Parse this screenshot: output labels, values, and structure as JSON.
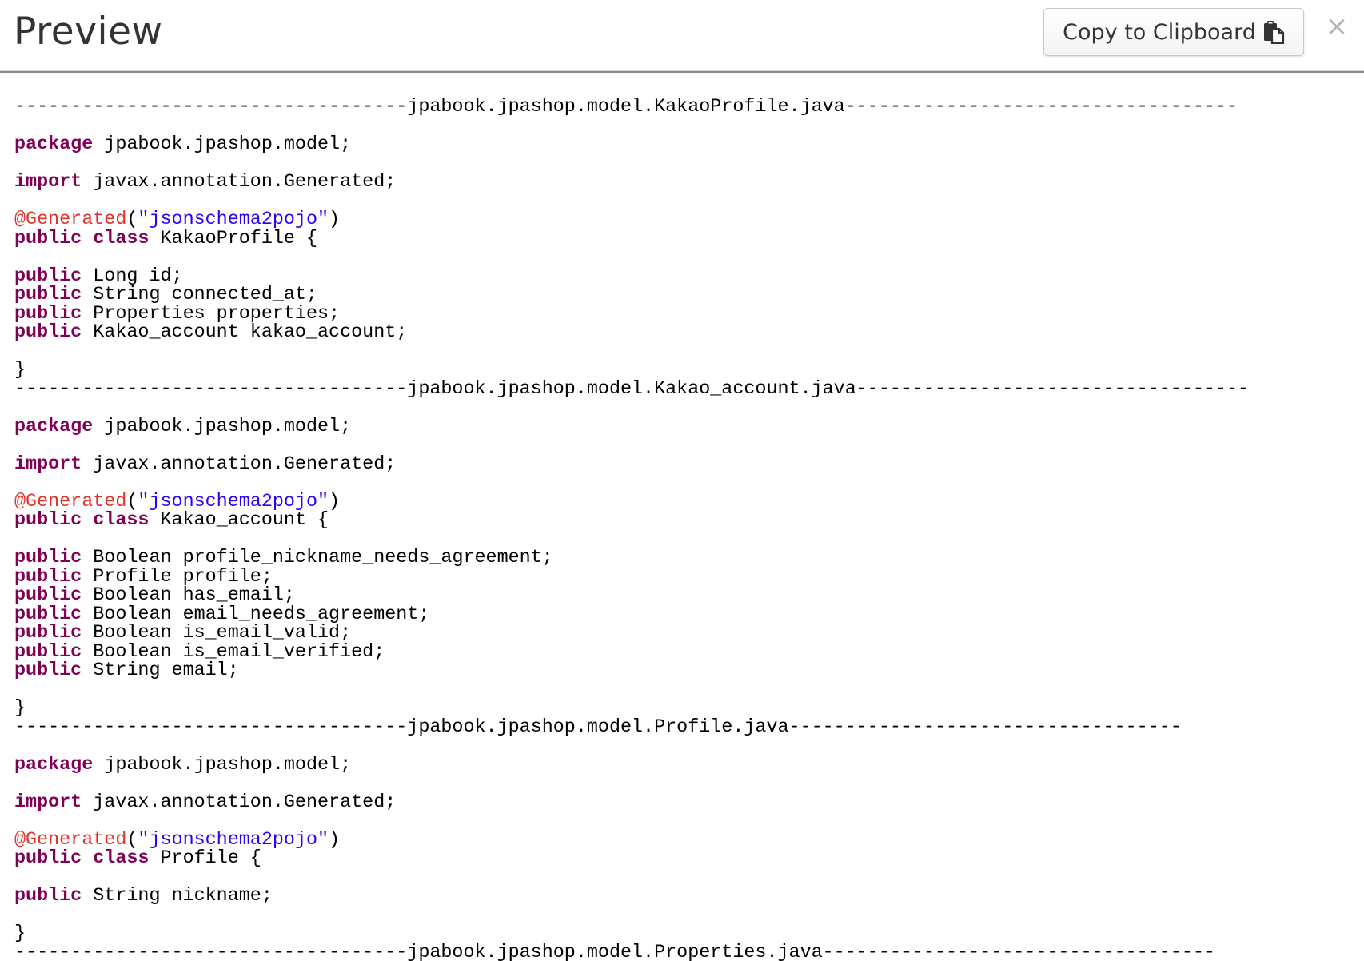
{
  "header": {
    "title": "Preview",
    "copy_button_label": "Copy to Clipboard",
    "copy_icon": "clipboard-icon",
    "close_label": "×"
  },
  "colors": {
    "keyword": "#7f0055",
    "annotation": "#e0332a",
    "string": "#2a00ff",
    "text": "#000000"
  },
  "code_lines": [
    [
      {
        "t": "-----------------------------------jpabook.jpashop.model.KakaoProfile.java-----------------------------------",
        "k": "p"
      }
    ],
    [],
    [
      {
        "t": "package",
        "k": "kw"
      },
      {
        "t": " jpabook.jpashop.model;",
        "k": "p"
      }
    ],
    [],
    [
      {
        "t": "import",
        "k": "kw"
      },
      {
        "t": " javax.annotation.Generated;",
        "k": "p"
      }
    ],
    [],
    [
      {
        "t": "@Generated",
        "k": "ann"
      },
      {
        "t": "(",
        "k": "p"
      },
      {
        "t": "\"jsonschema2pojo\"",
        "k": "str"
      },
      {
        "t": ")",
        "k": "p"
      }
    ],
    [
      {
        "t": "public",
        "k": "kw"
      },
      {
        "t": " ",
        "k": "p"
      },
      {
        "t": "class",
        "k": "kw"
      },
      {
        "t": " KakaoProfile {",
        "k": "p"
      }
    ],
    [],
    [
      {
        "t": "public",
        "k": "kw"
      },
      {
        "t": " Long id;",
        "k": "p"
      }
    ],
    [
      {
        "t": "public",
        "k": "kw"
      },
      {
        "t": " String connected_at;",
        "k": "p"
      }
    ],
    [
      {
        "t": "public",
        "k": "kw"
      },
      {
        "t": " Properties properties;",
        "k": "p"
      }
    ],
    [
      {
        "t": "public",
        "k": "kw"
      },
      {
        "t": " Kakao_account kakao_account;",
        "k": "p"
      }
    ],
    [],
    [
      {
        "t": "}",
        "k": "p"
      }
    ],
    [
      {
        "t": "-----------------------------------jpabook.jpashop.model.Kakao_account.java-----------------------------------",
        "k": "p"
      }
    ],
    [],
    [
      {
        "t": "package",
        "k": "kw"
      },
      {
        "t": " jpabook.jpashop.model;",
        "k": "p"
      }
    ],
    [],
    [
      {
        "t": "import",
        "k": "kw"
      },
      {
        "t": " javax.annotation.Generated;",
        "k": "p"
      }
    ],
    [],
    [
      {
        "t": "@Generated",
        "k": "ann"
      },
      {
        "t": "(",
        "k": "p"
      },
      {
        "t": "\"jsonschema2pojo\"",
        "k": "str"
      },
      {
        "t": ")",
        "k": "p"
      }
    ],
    [
      {
        "t": "public",
        "k": "kw"
      },
      {
        "t": " ",
        "k": "p"
      },
      {
        "t": "class",
        "k": "kw"
      },
      {
        "t": " Kakao_account {",
        "k": "p"
      }
    ],
    [],
    [
      {
        "t": "public",
        "k": "kw"
      },
      {
        "t": " Boolean profile_nickname_needs_agreement;",
        "k": "p"
      }
    ],
    [
      {
        "t": "public",
        "k": "kw"
      },
      {
        "t": " Profile profile;",
        "k": "p"
      }
    ],
    [
      {
        "t": "public",
        "k": "kw"
      },
      {
        "t": " Boolean has_email;",
        "k": "p"
      }
    ],
    [
      {
        "t": "public",
        "k": "kw"
      },
      {
        "t": " Boolean email_needs_agreement;",
        "k": "p"
      }
    ],
    [
      {
        "t": "public",
        "k": "kw"
      },
      {
        "t": " Boolean is_email_valid;",
        "k": "p"
      }
    ],
    [
      {
        "t": "public",
        "k": "kw"
      },
      {
        "t": " Boolean is_email_verified;",
        "k": "p"
      }
    ],
    [
      {
        "t": "public",
        "k": "kw"
      },
      {
        "t": " String email;",
        "k": "p"
      }
    ],
    [],
    [
      {
        "t": "}",
        "k": "p"
      }
    ],
    [
      {
        "t": "-----------------------------------jpabook.jpashop.model.Profile.java-----------------------------------",
        "k": "p"
      }
    ],
    [],
    [
      {
        "t": "package",
        "k": "kw"
      },
      {
        "t": " jpabook.jpashop.model;",
        "k": "p"
      }
    ],
    [],
    [
      {
        "t": "import",
        "k": "kw"
      },
      {
        "t": " javax.annotation.Generated;",
        "k": "p"
      }
    ],
    [],
    [
      {
        "t": "@Generated",
        "k": "ann"
      },
      {
        "t": "(",
        "k": "p"
      },
      {
        "t": "\"jsonschema2pojo\"",
        "k": "str"
      },
      {
        "t": ")",
        "k": "p"
      }
    ],
    [
      {
        "t": "public",
        "k": "kw"
      },
      {
        "t": " ",
        "k": "p"
      },
      {
        "t": "class",
        "k": "kw"
      },
      {
        "t": " Profile {",
        "k": "p"
      }
    ],
    [],
    [
      {
        "t": "public",
        "k": "kw"
      },
      {
        "t": " String nickname;",
        "k": "p"
      }
    ],
    [],
    [
      {
        "t": "}",
        "k": "p"
      }
    ],
    [
      {
        "t": "-----------------------------------jpabook.jpashop.model.Properties.java-----------------------------------",
        "k": "p"
      }
    ]
  ]
}
